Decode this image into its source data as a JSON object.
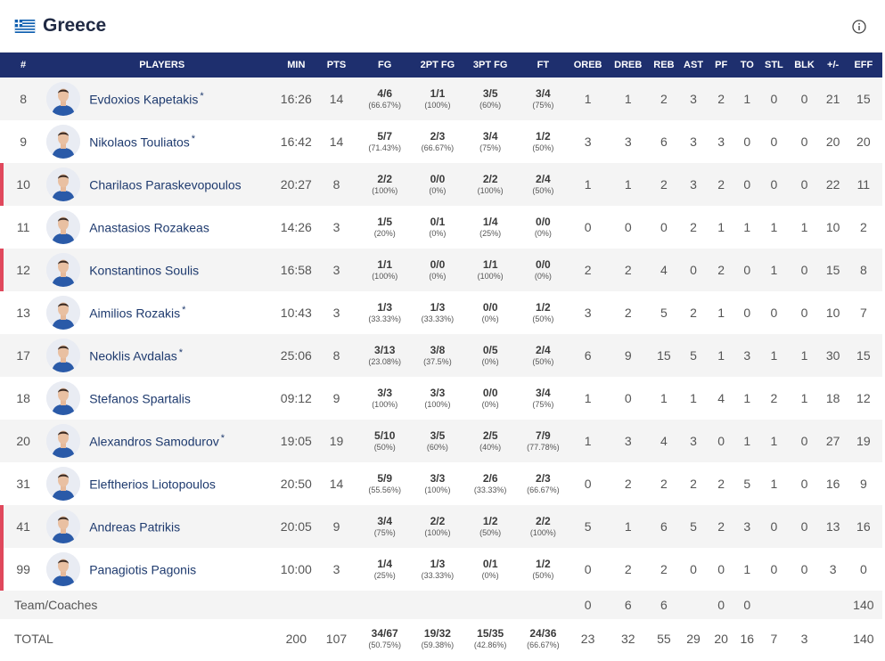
{
  "team": {
    "name": "Greece",
    "flag": "greece-flag-icon"
  },
  "colors": {
    "header_bg": "#1e2f6e",
    "accent": "#e0485c",
    "name_link": "#1e3a6e"
  },
  "columns": [
    "#",
    "PLAYERS",
    "MIN",
    "PTS",
    "FG",
    "2PT FG",
    "3PT FG",
    "FT",
    "OREB",
    "DREB",
    "REB",
    "AST",
    "PF",
    "TO",
    "STL",
    "BLK",
    "+/-",
    "EFF"
  ],
  "players": [
    {
      "num": "8",
      "name": "Evdoxios Kapetakis",
      "starter": "*",
      "accent": false,
      "min": "16:26",
      "pts": "14",
      "fg": "4/6",
      "fg_pct": "(66.67%)",
      "fg2": "1/1",
      "fg2_pct": "(100%)",
      "fg3": "3/5",
      "fg3_pct": "(60%)",
      "ft": "3/4",
      "ft_pct": "(75%)",
      "oreb": "1",
      "dreb": "1",
      "reb": "2",
      "ast": "3",
      "pf": "2",
      "to": "1",
      "stl": "0",
      "blk": "0",
      "pm": "21",
      "eff": "15"
    },
    {
      "num": "9",
      "name": "Nikolaos Touliatos",
      "starter": "*",
      "accent": false,
      "min": "16:42",
      "pts": "14",
      "fg": "5/7",
      "fg_pct": "(71.43%)",
      "fg2": "2/3",
      "fg2_pct": "(66.67%)",
      "fg3": "3/4",
      "fg3_pct": "(75%)",
      "ft": "1/2",
      "ft_pct": "(50%)",
      "oreb": "3",
      "dreb": "3",
      "reb": "6",
      "ast": "3",
      "pf": "3",
      "to": "0",
      "stl": "0",
      "blk": "0",
      "pm": "20",
      "eff": "20"
    },
    {
      "num": "10",
      "name": "Charilaos Paraskevopoulos",
      "starter": "",
      "accent": true,
      "min": "20:27",
      "pts": "8",
      "fg": "2/2",
      "fg_pct": "(100%)",
      "fg2": "0/0",
      "fg2_pct": "(0%)",
      "fg3": "2/2",
      "fg3_pct": "(100%)",
      "ft": "2/4",
      "ft_pct": "(50%)",
      "oreb": "1",
      "dreb": "1",
      "reb": "2",
      "ast": "3",
      "pf": "2",
      "to": "0",
      "stl": "0",
      "blk": "0",
      "pm": "22",
      "eff": "11"
    },
    {
      "num": "11",
      "name": "Anastasios Rozakeas",
      "starter": "",
      "accent": false,
      "min": "14:26",
      "pts": "3",
      "fg": "1/5",
      "fg_pct": "(20%)",
      "fg2": "0/1",
      "fg2_pct": "(0%)",
      "fg3": "1/4",
      "fg3_pct": "(25%)",
      "ft": "0/0",
      "ft_pct": "(0%)",
      "oreb": "0",
      "dreb": "0",
      "reb": "0",
      "ast": "2",
      "pf": "1",
      "to": "1",
      "stl": "1",
      "blk": "1",
      "pm": "10",
      "eff": "2"
    },
    {
      "num": "12",
      "name": "Konstantinos Soulis",
      "starter": "",
      "accent": true,
      "min": "16:58",
      "pts": "3",
      "fg": "1/1",
      "fg_pct": "(100%)",
      "fg2": "0/0",
      "fg2_pct": "(0%)",
      "fg3": "1/1",
      "fg3_pct": "(100%)",
      "ft": "0/0",
      "ft_pct": "(0%)",
      "oreb": "2",
      "dreb": "2",
      "reb": "4",
      "ast": "0",
      "pf": "2",
      "to": "0",
      "stl": "1",
      "blk": "0",
      "pm": "15",
      "eff": "8"
    },
    {
      "num": "13",
      "name": "Aimilios Rozakis",
      "starter": "*",
      "accent": false,
      "min": "10:43",
      "pts": "3",
      "fg": "1/3",
      "fg_pct": "(33.33%)",
      "fg2": "1/3",
      "fg2_pct": "(33.33%)",
      "fg3": "0/0",
      "fg3_pct": "(0%)",
      "ft": "1/2",
      "ft_pct": "(50%)",
      "oreb": "3",
      "dreb": "2",
      "reb": "5",
      "ast": "2",
      "pf": "1",
      "to": "0",
      "stl": "0",
      "blk": "0",
      "pm": "10",
      "eff": "7"
    },
    {
      "num": "17",
      "name": "Neoklis Avdalas",
      "starter": "*",
      "accent": false,
      "min": "25:06",
      "pts": "8",
      "fg": "3/13",
      "fg_pct": "(23.08%)",
      "fg2": "3/8",
      "fg2_pct": "(37.5%)",
      "fg3": "0/5",
      "fg3_pct": "(0%)",
      "ft": "2/4",
      "ft_pct": "(50%)",
      "oreb": "6",
      "dreb": "9",
      "reb": "15",
      "ast": "5",
      "pf": "1",
      "to": "3",
      "stl": "1",
      "blk": "1",
      "pm": "30",
      "eff": "15"
    },
    {
      "num": "18",
      "name": "Stefanos Spartalis",
      "starter": "",
      "accent": false,
      "min": "09:12",
      "pts": "9",
      "fg": "3/3",
      "fg_pct": "(100%)",
      "fg2": "3/3",
      "fg2_pct": "(100%)",
      "fg3": "0/0",
      "fg3_pct": "(0%)",
      "ft": "3/4",
      "ft_pct": "(75%)",
      "oreb": "1",
      "dreb": "0",
      "reb": "1",
      "ast": "1",
      "pf": "4",
      "to": "1",
      "stl": "2",
      "blk": "1",
      "pm": "18",
      "eff": "12"
    },
    {
      "num": "20",
      "name": "Alexandros Samodurov",
      "starter": "*",
      "accent": false,
      "min": "19:05",
      "pts": "19",
      "fg": "5/10",
      "fg_pct": "(50%)",
      "fg2": "3/5",
      "fg2_pct": "(60%)",
      "fg3": "2/5",
      "fg3_pct": "(40%)",
      "ft": "7/9",
      "ft_pct": "(77.78%)",
      "oreb": "1",
      "dreb": "3",
      "reb": "4",
      "ast": "3",
      "pf": "0",
      "to": "1",
      "stl": "1",
      "blk": "0",
      "pm": "27",
      "eff": "19"
    },
    {
      "num": "31",
      "name": "Eleftherios Liotopoulos",
      "starter": "",
      "accent": false,
      "min": "20:50",
      "pts": "14",
      "fg": "5/9",
      "fg_pct": "(55.56%)",
      "fg2": "3/3",
      "fg2_pct": "(100%)",
      "fg3": "2/6",
      "fg3_pct": "(33.33%)",
      "ft": "2/3",
      "ft_pct": "(66.67%)",
      "oreb": "0",
      "dreb": "2",
      "reb": "2",
      "ast": "2",
      "pf": "2",
      "to": "5",
      "stl": "1",
      "blk": "0",
      "pm": "16",
      "eff": "9"
    },
    {
      "num": "41",
      "name": "Andreas Patrikis",
      "starter": "",
      "accent": true,
      "min": "20:05",
      "pts": "9",
      "fg": "3/4",
      "fg_pct": "(75%)",
      "fg2": "2/2",
      "fg2_pct": "(100%)",
      "fg3": "1/2",
      "fg3_pct": "(50%)",
      "ft": "2/2",
      "ft_pct": "(100%)",
      "oreb": "5",
      "dreb": "1",
      "reb": "6",
      "ast": "5",
      "pf": "2",
      "to": "3",
      "stl": "0",
      "blk": "0",
      "pm": "13",
      "eff": "16"
    },
    {
      "num": "99",
      "name": "Panagiotis Pagonis",
      "starter": "",
      "accent": true,
      "min": "10:00",
      "pts": "3",
      "fg": "1/4",
      "fg_pct": "(25%)",
      "fg2": "1/3",
      "fg2_pct": "(33.33%)",
      "fg3": "0/1",
      "fg3_pct": "(0%)",
      "ft": "1/2",
      "ft_pct": "(50%)",
      "oreb": "0",
      "dreb": "2",
      "reb": "2",
      "ast": "0",
      "pf": "0",
      "to": "1",
      "stl": "0",
      "blk": "0",
      "pm": "3",
      "eff": "0"
    }
  ],
  "coaches": {
    "label": "Team/Coaches",
    "oreb": "0",
    "dreb": "6",
    "reb": "6",
    "pf": "0",
    "to": "0",
    "eff": "140"
  },
  "total": {
    "label": "TOTAL",
    "min": "200",
    "pts": "107",
    "fg": "34/67",
    "fg_pct": "(50.75%)",
    "fg2": "19/32",
    "fg2_pct": "(59.38%)",
    "fg3": "15/35",
    "fg3_pct": "(42.86%)",
    "ft": "24/36",
    "ft_pct": "(66.67%)",
    "oreb": "23",
    "dreb": "32",
    "reb": "55",
    "ast": "29",
    "pf": "20",
    "to": "16",
    "stl": "7",
    "blk": "3",
    "eff": "140"
  }
}
